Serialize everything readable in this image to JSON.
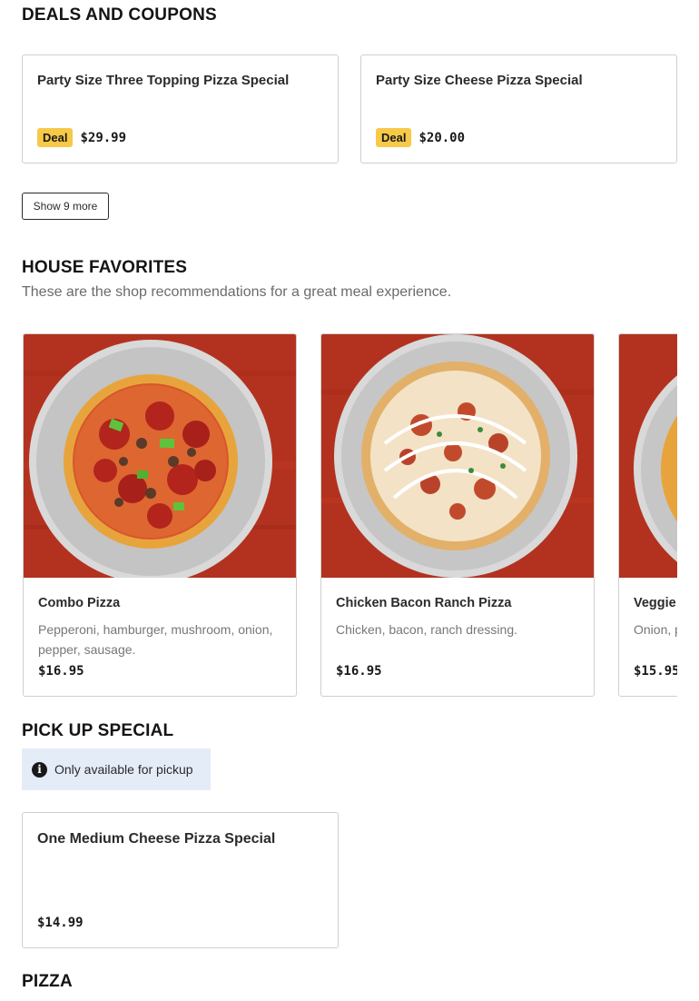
{
  "deals": {
    "title": "DEALS AND COUPONS",
    "cards": [
      {
        "title": "Party Size Three Topping Pizza Special",
        "badge": "Deal",
        "price": "$29.99"
      },
      {
        "title": "Party Size Cheese Pizza Special",
        "badge": "Deal",
        "price": "$20.00"
      }
    ],
    "show_more_label": "Show 9 more"
  },
  "favorites": {
    "title": "HOUSE FAVORITES",
    "subtitle": "These are the shop recommendations for a great meal experience.",
    "cards": [
      {
        "title": "Combo Pizza",
        "desc": "Pepperoni, hamburger, mushroom, onion, pepper, sausage.",
        "price": "$16.95"
      },
      {
        "title": "Chicken Bacon Ranch Pizza",
        "desc": "Chicken, bacon, ranch dressing.",
        "price": "$16.95"
      },
      {
        "title": "Veggie",
        "desc": "Onion, p tomato",
        "price": "$15.95"
      }
    ]
  },
  "pickup": {
    "title": "PICK UP SPECIAL",
    "notice": "Only available for pickup",
    "card": {
      "title": "One Medium Cheese Pizza Special",
      "price": "$14.99"
    }
  },
  "pizza": {
    "title": "PIZZA"
  },
  "colors": {
    "badge": "#f7c948",
    "notice_bg": "#e4ecf7",
    "table_red": "#b3321f"
  }
}
